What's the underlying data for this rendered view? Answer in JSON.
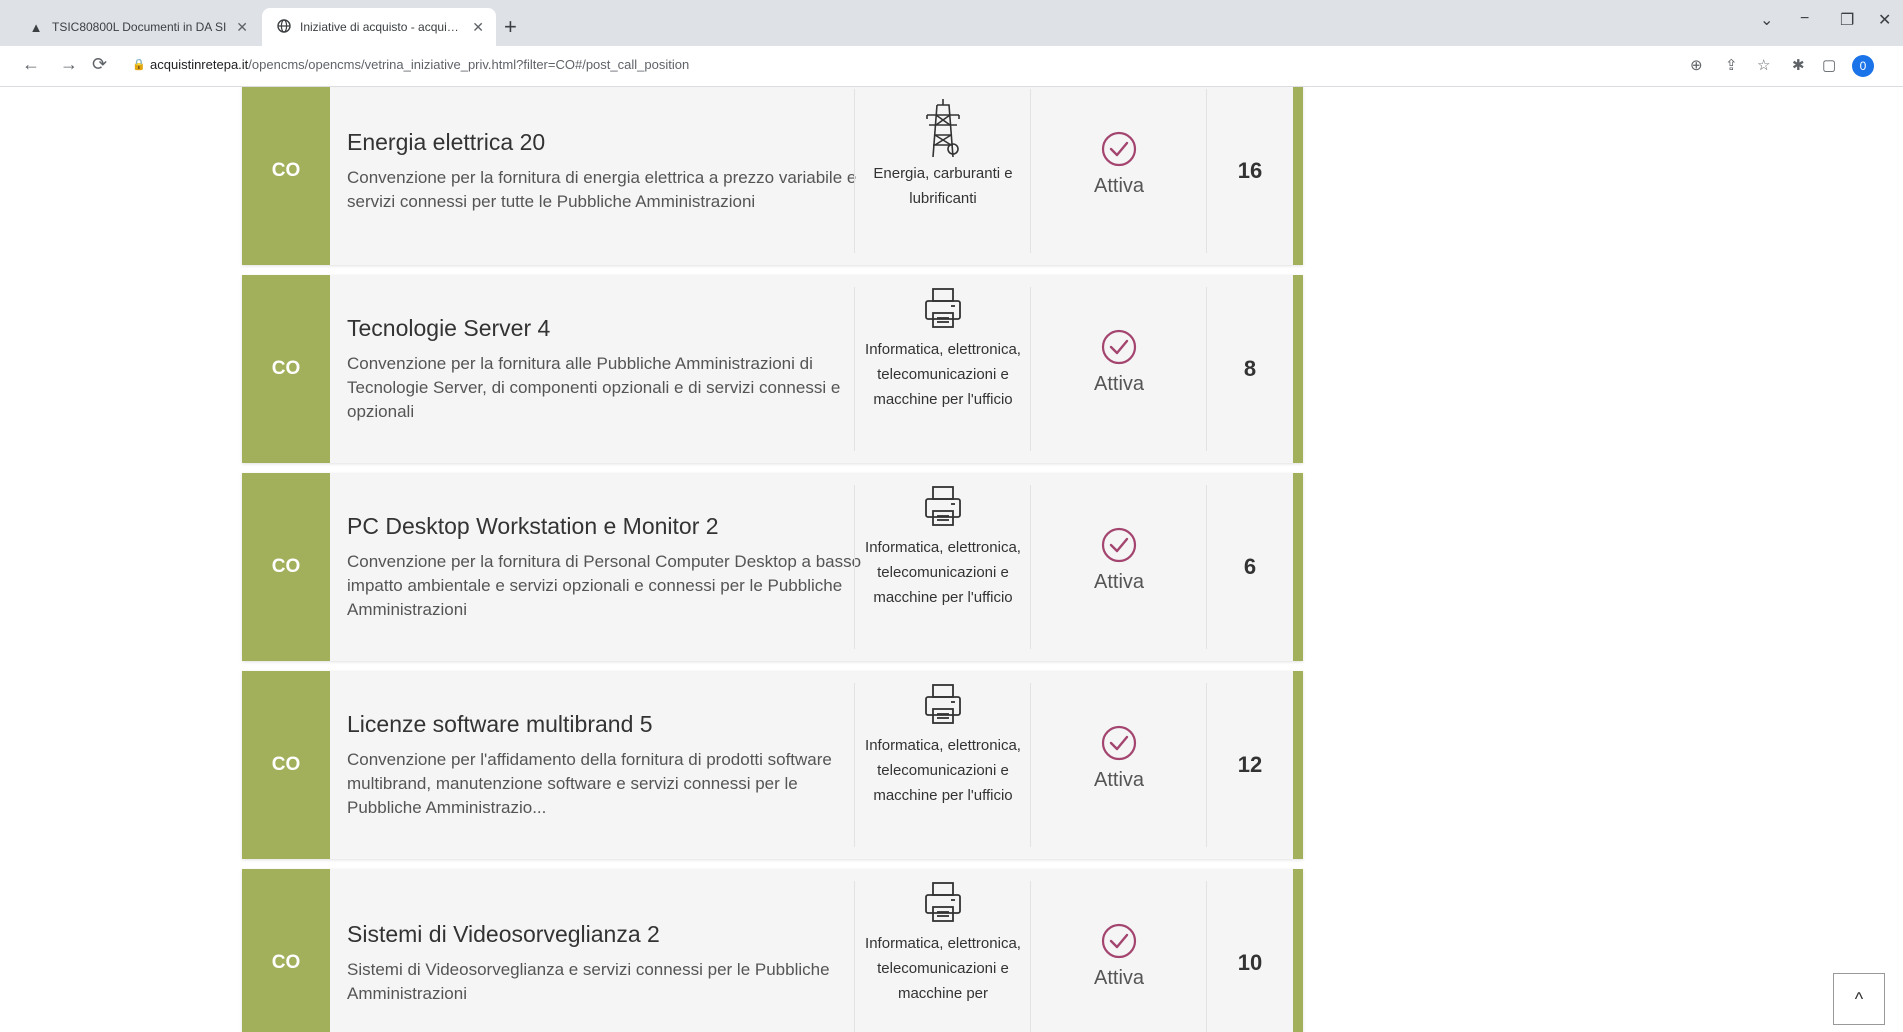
{
  "browser": {
    "tabs": [
      {
        "label": "TSIC80800L Documenti in DA SI",
        "icon": "drive-icon",
        "active": false
      },
      {
        "label": "Iniziative di acquisto - acquistin",
        "icon": "globe-icon",
        "active": true
      }
    ],
    "new_tab": "+",
    "window_controls": [
      "⌄",
      "−",
      "❐",
      "✕"
    ],
    "url_host": "acquistinretepa.it",
    "url_path": "/opencms/opencms/vetrina_iniziative_priv.html?filter=CO#/post_call_position",
    "profile_initial": "0"
  },
  "accent_color": "#a2b05c",
  "rows": [
    {
      "badge": "CO",
      "title": "Energia elettrica 20",
      "description": "Convenzione per la fornitura di energia elettrica a prezzo variabile e servizi connessi per tutte le Pubbliche Amministrazioni",
      "category_icon": "power-tower-icon",
      "category": "Energia, carburanti e lubrificanti",
      "status": "Attiva",
      "count": "16"
    },
    {
      "badge": "CO",
      "title": "Tecnologie Server 4",
      "description": "Convenzione per la fornitura alle Pubbliche Amministrazioni di Tecnologie Server, di componenti opzionali e di servizi connessi e opzionali",
      "category_icon": "printer-icon",
      "category": "Informatica, elettronica, telecomunicazioni e macchine per l'ufficio",
      "status": "Attiva",
      "count": "8"
    },
    {
      "badge": "CO",
      "title": "PC Desktop Workstation e Monitor 2",
      "description": "Convenzione per la fornitura di Personal Computer Desktop a basso impatto ambientale e servizi opzionali e connessi per le Pubbliche Amministrazioni",
      "category_icon": "printer-icon",
      "category": "Informatica, elettronica, telecomunicazioni e macchine per l'ufficio",
      "status": "Attiva",
      "count": "6"
    },
    {
      "badge": "CO",
      "title": "Licenze software multibrand 5",
      "description": "Convenzione per l'affidamento della fornitura di prodotti software multibrand, manutenzione software e servizi connessi per le Pubbliche Amministrazio...",
      "category_icon": "printer-icon",
      "category": "Informatica, elettronica, telecomunicazioni e macchine per l'ufficio",
      "status": "Attiva",
      "count": "12"
    },
    {
      "badge": "CO",
      "title": "Sistemi di Videosorveglianza 2",
      "description": "Sistemi di Videosorveglianza e servizi connessi per le Pubbliche Amministrazioni",
      "category_icon": "printer-icon",
      "category": "Informatica, elettronica, telecomunicazioni e macchine per",
      "status": "Attiva",
      "count": "10"
    }
  ],
  "scroll_top_label": "^"
}
